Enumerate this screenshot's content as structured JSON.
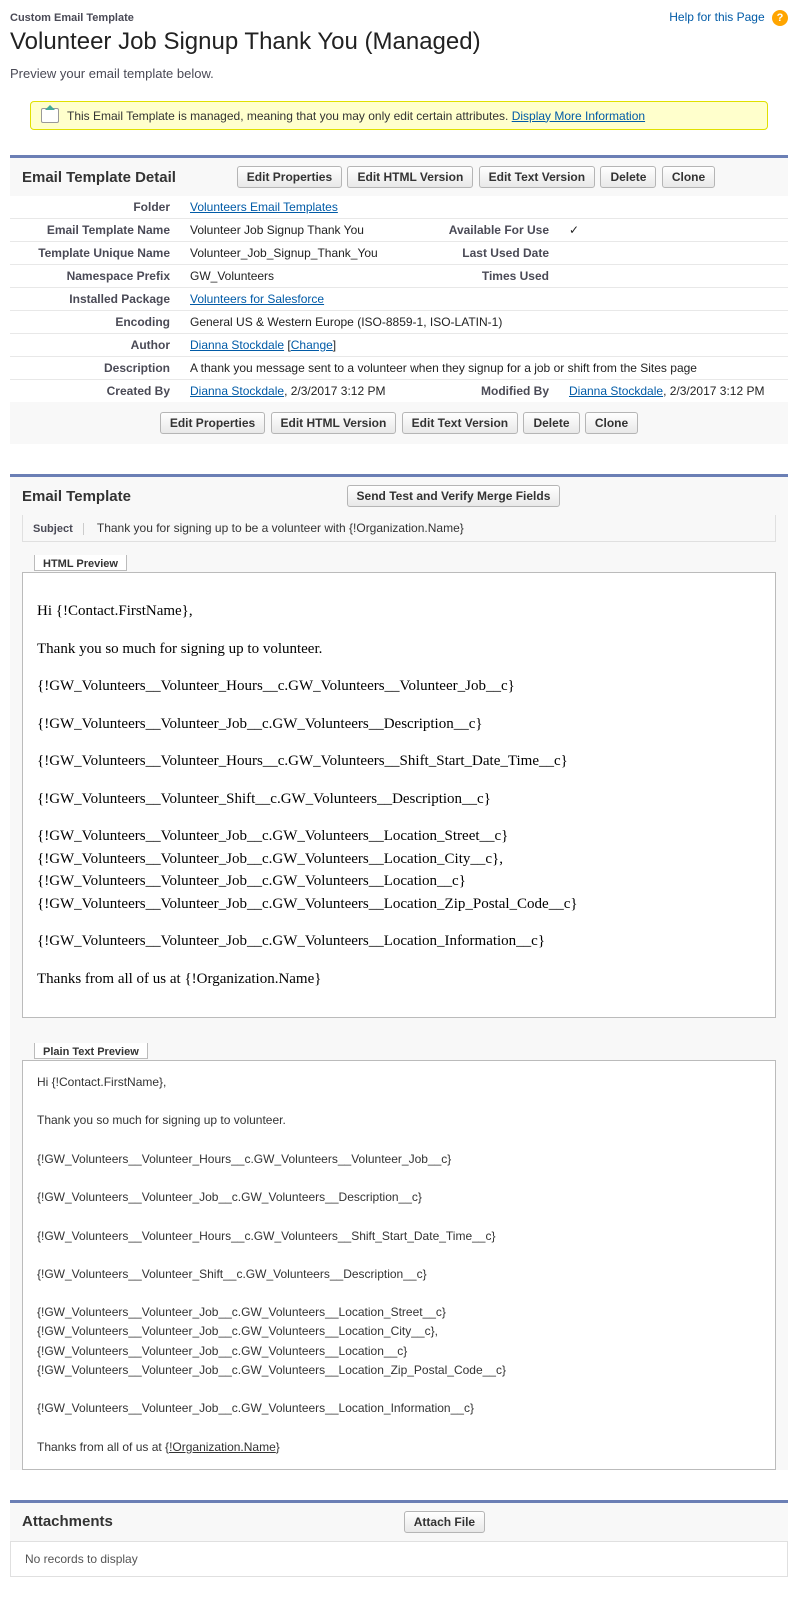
{
  "header": {
    "eyebrow": "Custom Email Template",
    "title": "Volunteer Job Signup Thank You (Managed)",
    "help_link": "Help for this Page"
  },
  "intro": "Preview your email template below.",
  "notice": {
    "text": "This Email Template is managed, meaning that you may only edit certain attributes.",
    "link": "Display More Information"
  },
  "buttons": {
    "edit_properties": "Edit Properties",
    "edit_html": "Edit HTML Version",
    "edit_text": "Edit Text Version",
    "delete": "Delete",
    "clone": "Clone",
    "send_test": "Send Test and Verify Merge Fields",
    "attach_file": "Attach File"
  },
  "sections": {
    "detail_title": "Email Template Detail",
    "template_title": "Email Template",
    "attachments_title": "Attachments"
  },
  "detail": {
    "folder_label": "Folder",
    "folder_value": "Volunteers Email Templates",
    "name_label": "Email Template Name",
    "name_value": "Volunteer Job Signup Thank You",
    "available_label": "Available For Use",
    "available_value": "✓",
    "unique_label": "Template Unique Name",
    "unique_value": "Volunteer_Job_Signup_Thank_You",
    "lastused_label": "Last Used Date",
    "lastused_value": "",
    "ns_label": "Namespace Prefix",
    "ns_value": "GW_Volunteers",
    "times_label": "Times Used",
    "times_value": "",
    "pkg_label": "Installed Package",
    "pkg_value": "Volunteers for Salesforce",
    "enc_label": "Encoding",
    "enc_value": "General US & Western Europe (ISO-8859-1, ISO-LATIN-1)",
    "author_label": "Author",
    "author_name": "Dianna Stockdale",
    "author_change": "Change",
    "desc_label": "Description",
    "desc_value": "A thank you message sent to a volunteer when they signup for a job or shift from the Sites page",
    "created_label": "Created By",
    "created_name": "Dianna Stockdale",
    "created_date": ", 2/3/2017 3:12 PM",
    "modified_label": "Modified By",
    "modified_name": "Dianna Stockdale",
    "modified_date": ", 2/3/2017 3:12 PM"
  },
  "template": {
    "subject_label": "Subject",
    "subject_value": "Thank you for signing up to be a volunteer with {!Organization.Name}",
    "html_preview_label": "HTML Preview",
    "plain_preview_label": "Plain Text Preview",
    "body": {
      "greeting": "Hi {!Contact.FirstName},",
      "line1": "Thank you so much for signing up to volunteer.",
      "merge1": "{!GW_Volunteers__Volunteer_Hours__c.GW_Volunteers__Volunteer_Job__c}",
      "merge2": "{!GW_Volunteers__Volunteer_Job__c.GW_Volunteers__Description__c}",
      "merge3": "{!GW_Volunteers__Volunteer_Hours__c.GW_Volunteers__Shift_Start_Date_Time__c}",
      "merge4": "{!GW_Volunteers__Volunteer_Shift__c.GW_Volunteers__Description__c}",
      "loc1": "{!GW_Volunteers__Volunteer_Job__c.GW_Volunteers__Location_Street__c}",
      "loc2": "{!GW_Volunteers__Volunteer_Job__c.GW_Volunteers__Location_City__c},",
      "loc3": "{!GW_Volunteers__Volunteer_Job__c.GW_Volunteers__Location__c}",
      "loc4": "{!GW_Volunteers__Volunteer_Job__c.GW_Volunteers__Location_Zip_Postal_Code__c}",
      "merge5": "{!GW_Volunteers__Volunteer_Job__c.GW_Volunteers__Location_Information__c}",
      "closing_prefix": "Thanks from all of us at {",
      "closing_org": "!Organization.Name",
      "closing_suffix": "}",
      "closing_full": "Thanks from all of us at {!Organization.Name}"
    }
  },
  "attachments": {
    "no_records": "No records to display"
  }
}
